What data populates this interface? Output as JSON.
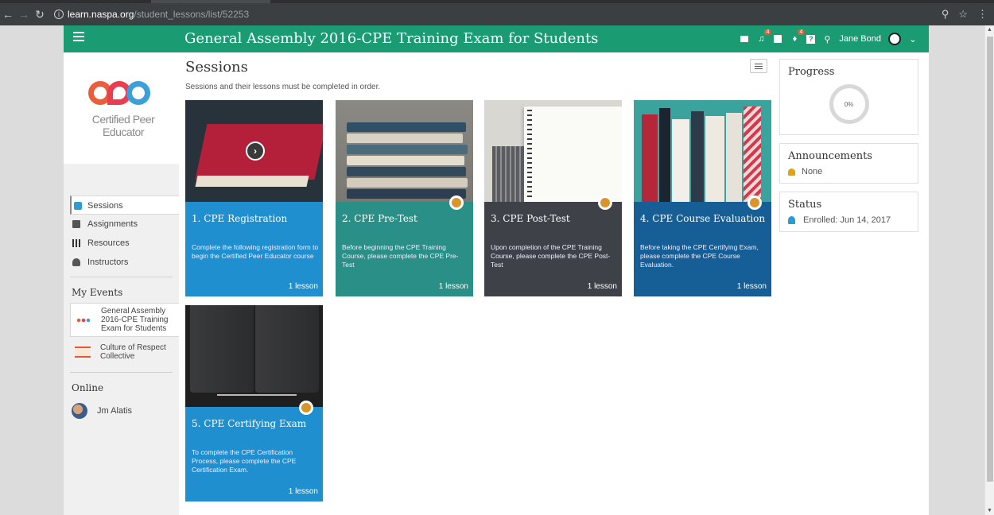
{
  "browser": {
    "url_host": "learn.naspa.org",
    "url_path": "/student_lessons/list/52253"
  },
  "header": {
    "title": "General Assembly 2016-CPE Training Exam for Students",
    "notifications_badge": "4",
    "cart_badge": "4",
    "user_name": "Jane Bond"
  },
  "sidebar": {
    "logo_text": "Certified Peer Educator",
    "nav": [
      {
        "label": "Sessions",
        "icon": "sessions-icon"
      },
      {
        "label": "Assignments",
        "icon": "assignments-icon"
      },
      {
        "label": "Resources",
        "icon": "resources-icon"
      },
      {
        "label": "Instructors",
        "icon": "instructors-icon"
      }
    ],
    "my_events_heading": "My Events",
    "events": [
      {
        "label": "General Assembly 2016-CPE Training Exam for Students"
      },
      {
        "label": "Culture of Respect Collective"
      }
    ],
    "online_heading": "Online",
    "online_users": [
      {
        "name": "Jm Alatis"
      }
    ]
  },
  "main": {
    "title": "Sessions",
    "subtitle": "Sessions and their lessons must be completed in order.",
    "sessions": [
      {
        "title": "1. CPE Registration",
        "description": "Complete the following registration form to begin the Certified Peer Educator course",
        "count": "1 lesson",
        "color": "#1f8fcf",
        "locked": false
      },
      {
        "title": "2. CPE Pre-Test",
        "description": "Before beginning the CPE Training Course, please complete the CPE Pre-Test",
        "count": "1 lesson",
        "color": "#2a8f86",
        "locked": true
      },
      {
        "title": "3. CPE Post-Test",
        "description": "Upon completion of the CPE Training Course, please complete the CPE Post-Test",
        "count": "1 lesson",
        "color": "#3e4248",
        "locked": true
      },
      {
        "title": "4. CPE Course Evaluation",
        "description": "Before taking the CPE Certifying Exam, please complete the CPE Course Evaluation.",
        "count": "1 lesson",
        "color": "#155f96",
        "locked": true
      },
      {
        "title": "5. CPE Certifying Exam",
        "description": "To complete the CPE Certification Process, please complete the CPE Certification Exam.",
        "count": "1 lesson",
        "color": "#1f8fcf",
        "locked": true
      }
    ]
  },
  "right": {
    "progress_title": "Progress",
    "progress_value": "0%",
    "announcements_title": "Announcements",
    "announcements_value": "None",
    "status_title": "Status",
    "status_value": "Enrolled: Jun 14, 2017"
  },
  "colors": {
    "header": "#1a9b72",
    "accent_blue": "#2a9bd5"
  }
}
